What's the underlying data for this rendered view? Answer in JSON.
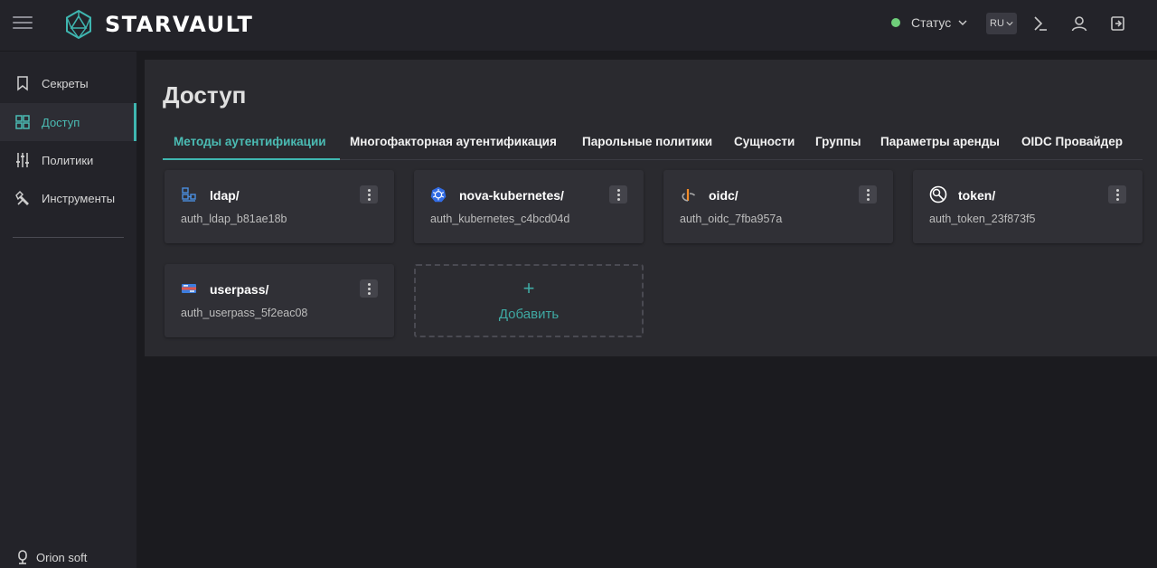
{
  "header": {
    "logo_text": "STARVAULT",
    "status_label": "Статус",
    "status_color": "#6fcf7a",
    "language": "RU"
  },
  "sidebar": {
    "items": [
      {
        "label": "Секреты",
        "icon": "bookmark-icon"
      },
      {
        "label": "Доступ",
        "icon": "grid-icon",
        "active": true
      },
      {
        "label": "Политики",
        "icon": "sliders-icon"
      },
      {
        "label": "Инструменты",
        "icon": "tools-icon"
      }
    ],
    "brand": "Orion soft"
  },
  "main": {
    "title": "Доступ",
    "tabs": [
      {
        "label": "Методы аутентификации",
        "active": true
      },
      {
        "label": "Многофакторная аутентификация"
      },
      {
        "label": "Парольные политики"
      },
      {
        "label": "Сущности"
      },
      {
        "label": "Группы"
      },
      {
        "label": "Параметры аренды"
      },
      {
        "label": "OIDC Провайдер"
      }
    ],
    "auth_methods": [
      {
        "name": "ldap/",
        "id": "auth_ldap_b81ae18b",
        "icon": "ldap-icon"
      },
      {
        "name": "nova-kubernetes/",
        "id": "auth_kubernetes_c4bcd04d",
        "icon": "kubernetes-icon"
      },
      {
        "name": "oidc/",
        "id": "auth_oidc_7fba957a",
        "icon": "oidc-icon"
      },
      {
        "name": "token/",
        "id": "auth_token_23f873f5",
        "icon": "token-icon"
      },
      {
        "name": "userpass/",
        "id": "auth_userpass_5f2eac08",
        "icon": "userpass-icon"
      }
    ],
    "add_label": "Добавить",
    "add_symbol": "+"
  },
  "colors": {
    "accent": "#3fb6b0",
    "background": "#1b1b1f",
    "panel": "#2a2a2f",
    "card": "#303036"
  }
}
